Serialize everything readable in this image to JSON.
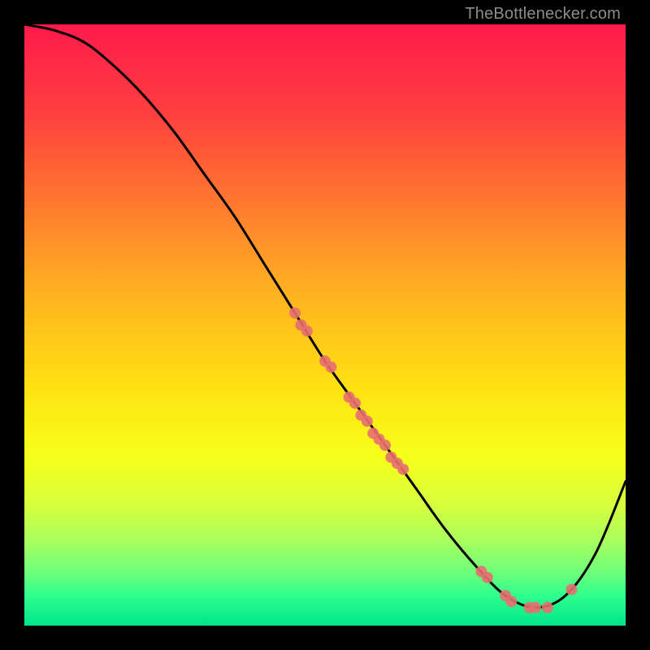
{
  "watermark": "TheBottlenecker.com",
  "chart_data": {
    "type": "line",
    "title": "",
    "xlabel": "",
    "ylabel": "",
    "xlim": [
      0,
      100
    ],
    "ylim": [
      0,
      100
    ],
    "background": {
      "type": "vertical-gradient",
      "stops": [
        {
          "offset": 0.0,
          "color": "#ff1a4b"
        },
        {
          "offset": 0.15,
          "color": "#ff3f3f"
        },
        {
          "offset": 0.3,
          "color": "#ff7a2e"
        },
        {
          "offset": 0.45,
          "color": "#ffb31f"
        },
        {
          "offset": 0.6,
          "color": "#ffe013"
        },
        {
          "offset": 0.72,
          "color": "#f7ff1a"
        },
        {
          "offset": 0.8,
          "color": "#d6ff3d"
        },
        {
          "offset": 0.86,
          "color": "#a8ff5e"
        },
        {
          "offset": 0.91,
          "color": "#6fff7a"
        },
        {
          "offset": 0.95,
          "color": "#2fff8e"
        },
        {
          "offset": 1.0,
          "color": "#00e58a"
        }
      ]
    },
    "series": [
      {
        "name": "bottleneck-curve",
        "color": "#000000",
        "x": [
          0,
          5,
          10,
          15,
          20,
          25,
          30,
          35,
          40,
          45,
          50,
          55,
          60,
          65,
          70,
          75,
          80,
          85,
          90,
          95,
          100
        ],
        "y": [
          100,
          99,
          97,
          93,
          88,
          82,
          75,
          68,
          60,
          52,
          44,
          37,
          30,
          23,
          16,
          10,
          5,
          3,
          5,
          12,
          24
        ]
      }
    ],
    "markers": {
      "name": "highlighted-points",
      "color": "#e76f6f",
      "radius": 7,
      "points": [
        {
          "x": 45,
          "y": 52
        },
        {
          "x": 46,
          "y": 50
        },
        {
          "x": 47,
          "y": 49
        },
        {
          "x": 50,
          "y": 44
        },
        {
          "x": 51,
          "y": 43
        },
        {
          "x": 54,
          "y": 38
        },
        {
          "x": 55,
          "y": 37
        },
        {
          "x": 56,
          "y": 35
        },
        {
          "x": 57,
          "y": 34
        },
        {
          "x": 58,
          "y": 32
        },
        {
          "x": 59,
          "y": 31
        },
        {
          "x": 60,
          "y": 30
        },
        {
          "x": 61,
          "y": 28
        },
        {
          "x": 62,
          "y": 27
        },
        {
          "x": 63,
          "y": 26
        },
        {
          "x": 76,
          "y": 9
        },
        {
          "x": 77,
          "y": 8
        },
        {
          "x": 80,
          "y": 5
        },
        {
          "x": 81,
          "y": 4
        },
        {
          "x": 84,
          "y": 3
        },
        {
          "x": 85,
          "y": 3
        },
        {
          "x": 87,
          "y": 3
        },
        {
          "x": 91,
          "y": 6
        }
      ]
    }
  }
}
